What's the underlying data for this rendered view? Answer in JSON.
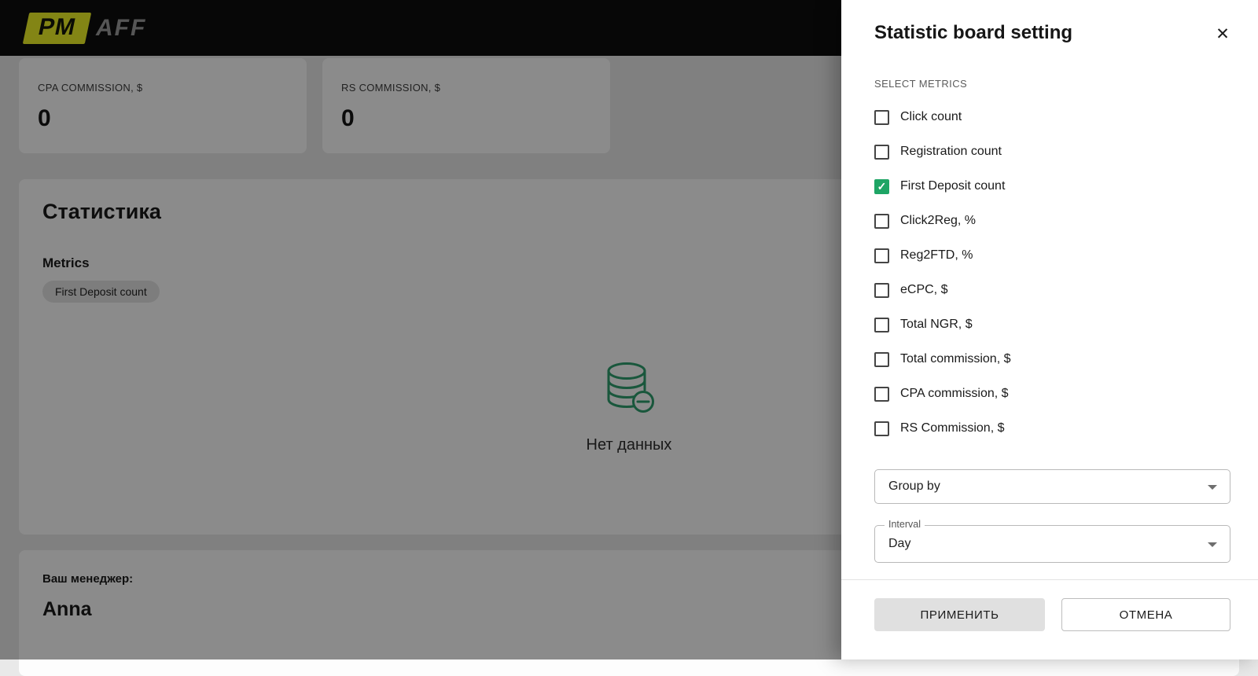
{
  "header": {
    "logo_pm": "PM",
    "logo_aff": "AFF"
  },
  "summary_cards": [
    {
      "label": "CPA COMMISSION, $",
      "value": "0"
    },
    {
      "label": "RS COMMISSION, $",
      "value": "0"
    }
  ],
  "stats_panel": {
    "title": "Статистика",
    "metrics_label": "Metrics",
    "selected_metric_chip": "First Deposit count",
    "empty_state_text": "Нет данных",
    "empty_state_icon": "database-minus-icon"
  },
  "manager_panel": {
    "label": "Ваш менеджер:",
    "name": "Anna"
  },
  "drawer": {
    "title": "Statistic board setting",
    "select_metrics_label": "SELECT METRICS",
    "metrics": [
      {
        "label": "Click count",
        "checked": false
      },
      {
        "label": "Registration count",
        "checked": false
      },
      {
        "label": "First Deposit count",
        "checked": true
      },
      {
        "label": "Click2Reg, %",
        "checked": false
      },
      {
        "label": "Reg2FTD, %",
        "checked": false
      },
      {
        "label": "eCPC, $",
        "checked": false
      },
      {
        "label": "Total NGR, $",
        "checked": false
      },
      {
        "label": "Total commission, $",
        "checked": false
      },
      {
        "label": "CPA commission, $",
        "checked": false
      },
      {
        "label": "RS Commission, $",
        "checked": false
      }
    ],
    "group_by_select": {
      "value": "Group by"
    },
    "interval_select": {
      "label": "Interval",
      "value": "Day"
    },
    "apply_label": "ПРИМЕНИТЬ",
    "cancel_label": "ОТМЕНА"
  },
  "icons": {
    "check": "✓",
    "close": "✕"
  },
  "colors": {
    "accent_green": "#1ea565",
    "brand_yellow": "#eff227",
    "icon_green": "#2f9e6e"
  }
}
